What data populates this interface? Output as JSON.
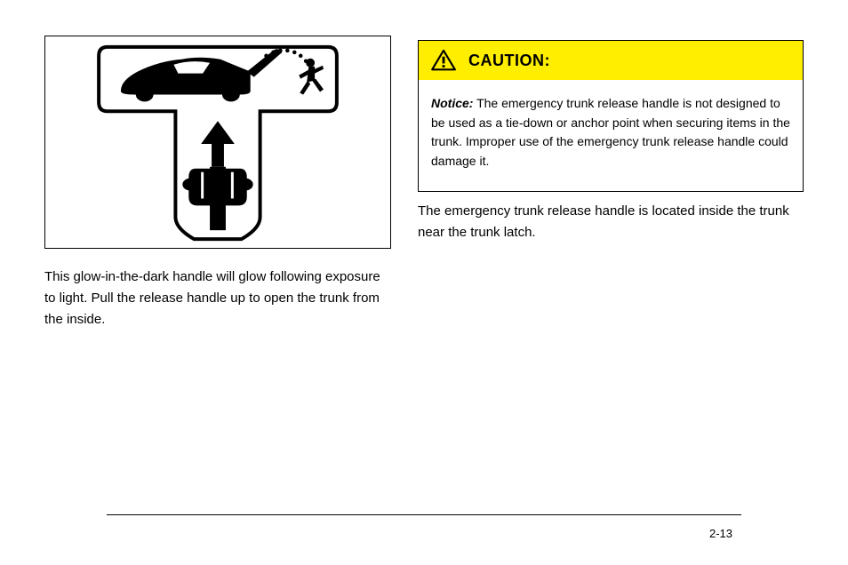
{
  "illustration": {
    "aria_label": "Trunk emergency release handle illustration: a T-shaped handle with a hand pulling upward, a car with open trunk, and a figure running away"
  },
  "instruction_text": "This glow-in-the-dark handle will glow following exposure to light. Pull the release handle up to open the trunk from the inside.",
  "caution": {
    "title": "CAUTION:",
    "notice_label": "Notice:",
    "body": " The emergency trunk release handle is not designed to be used as a tie-down or anchor point when securing items in the trunk. Improper use of the emergency trunk release handle could damage it."
  },
  "right_text": "The emergency trunk release handle is located inside the trunk near the trunk latch.",
  "page_number": "2-13"
}
